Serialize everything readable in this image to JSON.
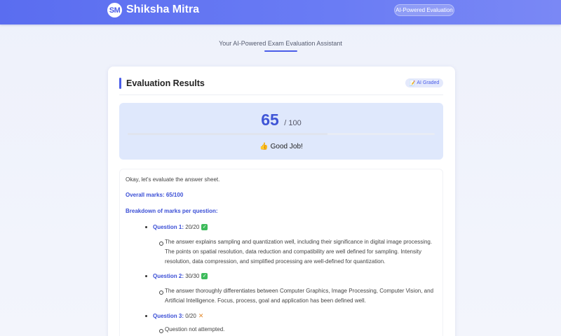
{
  "header": {
    "logo_initials": "SM",
    "brand": "Shiksha Mitra",
    "badge": "AI-Powered Evaluation"
  },
  "subtitle": "Your AI-Powered Exam Evaluation Assistant",
  "card": {
    "title": "Evaluation Results",
    "graded_badge": "AI Graded",
    "score": {
      "value": "65",
      "total": "/ 100",
      "progress_fraction": 0.65,
      "verdict": "Good Job!"
    }
  },
  "content": {
    "intro": "Okay, let's evaluate the answer sheet.",
    "overall": "Overall marks: 65/100",
    "breakdown_heading": "Breakdown of marks per question:",
    "questions": [
      {
        "label": "Question 1:",
        "marks": "20/20",
        "status": "check",
        "comment": "The answer explains sampling and quantization well, including their significance in digital image processing. The points on spatial resolution, data reduction and compatibility are well defined for sampling. Intensity resolution, data compression, and simplified processing are well-defined for quantization."
      },
      {
        "label": "Question 2:",
        "marks": "30/30",
        "status": "check",
        "comment": "The answer thoroughly differentiates between Computer Graphics, Image Processing, Computer Vision, and Artificial Intelligence. Focus, process, goal and application has been defined well."
      },
      {
        "label": "Question 3:",
        "marks": "0/20",
        "status": "cross",
        "comment": "Question not attempted."
      }
    ]
  }
}
